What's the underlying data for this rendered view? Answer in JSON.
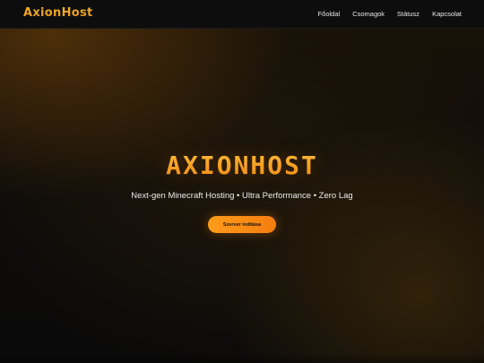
{
  "navbar": {
    "logo": "AxionHost",
    "links": [
      {
        "label": "Főoldal"
      },
      {
        "label": "Csomagok"
      },
      {
        "label": "Státusz"
      },
      {
        "label": "Kapcsolat"
      }
    ]
  },
  "hero": {
    "title": "AXIONHOST",
    "subtitle": "Next-gen Minecraft Hosting • Ultra Performance • Zero Lag",
    "cta_label": "Szerver indítása"
  },
  "colors": {
    "accent": "#f2a51c",
    "accent_dark": "#f57d0f",
    "nav_background": "#0d0d0d",
    "page_background": "#0e0c0a"
  }
}
